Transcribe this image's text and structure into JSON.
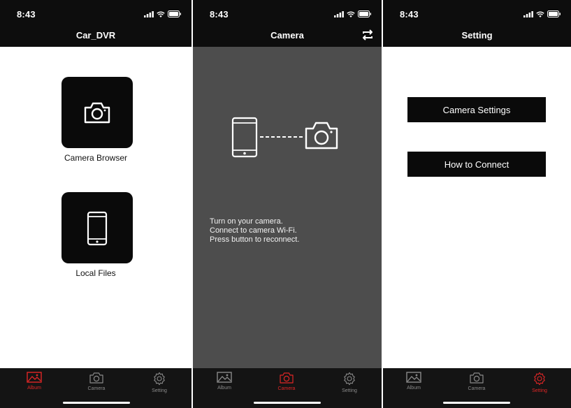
{
  "status": {
    "time": "8:43"
  },
  "colors": {
    "bar_bg": "#0d0d0d",
    "tab_active": "#e02626",
    "tab_inactive": "#8a8a8a",
    "camera_bg": "#4d4d4d"
  },
  "tabs": {
    "album": "Album",
    "camera": "Camera",
    "setting": "Setting"
  },
  "icons": {
    "album": "image-icon",
    "camera": "camera-icon",
    "setting": "gear-icon",
    "switch": "switch-camera-icon",
    "phone": "phone-icon"
  },
  "album_screen": {
    "title": "Car_DVR",
    "items": [
      {
        "label": "Camera Browser",
        "icon": "camera-icon"
      },
      {
        "label": "Local Files",
        "icon": "phone-icon"
      }
    ]
  },
  "camera_screen": {
    "title": "Camera",
    "instructions": [
      "Turn on your camera.",
      "Connect to camera Wi-Fi.",
      "Press button to reconnect."
    ]
  },
  "setting_screen": {
    "title": "Setting",
    "buttons": [
      "Camera Settings",
      "How to Connect"
    ]
  }
}
